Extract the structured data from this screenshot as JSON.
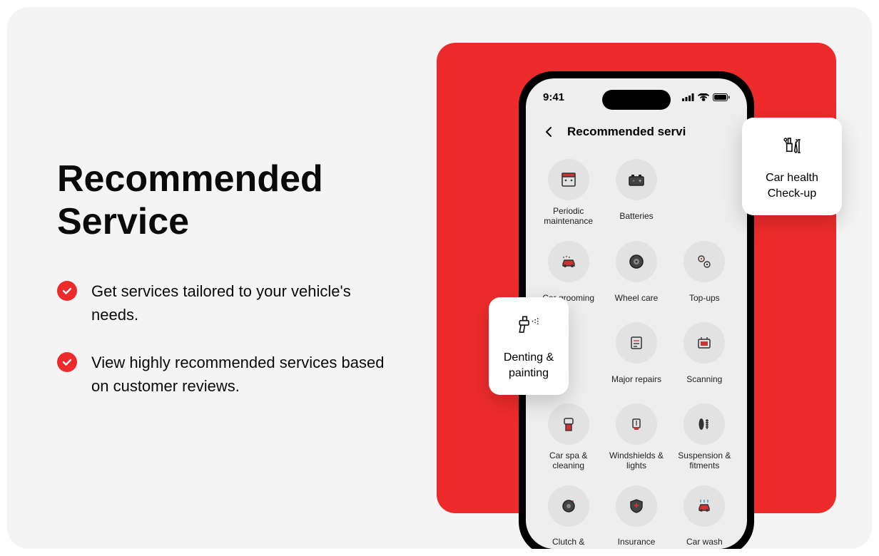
{
  "title": "Recommended Service",
  "bullets": [
    "Get services tailored to your vehicle's needs.",
    "View highly recommended services based on customer reviews."
  ],
  "statusbar": {
    "time": "9:41"
  },
  "header": {
    "title": "Recommended servi"
  },
  "services": [
    {
      "label": "Periodic maintenance"
    },
    {
      "label": "Batteries"
    },
    {
      "label": ""
    },
    {
      "label": "Car grooming"
    },
    {
      "label": "Wheel care"
    },
    {
      "label": "Top-ups"
    },
    {
      "label": ""
    },
    {
      "label": "Major repairs"
    },
    {
      "label": "Scanning"
    },
    {
      "label": "Car spa & cleaning"
    },
    {
      "label": "Windshields & lights"
    },
    {
      "label": "Suspension & fitments"
    },
    {
      "label": "Clutch &"
    },
    {
      "label": "Insurance"
    },
    {
      "label": "Car wash"
    }
  ],
  "floating": [
    {
      "label": "Car health Check-up"
    },
    {
      "label": "Denting & painting"
    }
  ]
}
